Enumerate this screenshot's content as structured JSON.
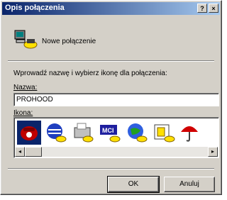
{
  "window": {
    "title": "Opis połączenia",
    "help_btn": "?",
    "close_btn": "×"
  },
  "header": {
    "connection_name": "Nowe połączenie"
  },
  "prompt": "Wprowadź nazwę i wybierz ikonę dla połączenia:",
  "name_field": {
    "label": "Nazwa:",
    "value": "PROHOOD"
  },
  "icon_field": {
    "label": "Ikona:",
    "icons": [
      "phone-icon",
      "globe-icon",
      "fax-icon",
      "mci-icon",
      "network-globe-icon",
      "folder-icon",
      "umbrella-icon"
    ],
    "mci_text": "MCI"
  },
  "buttons": {
    "ok": "OK",
    "cancel": "Anuluj"
  },
  "scroll": {
    "left": "◂",
    "right": "▸"
  }
}
